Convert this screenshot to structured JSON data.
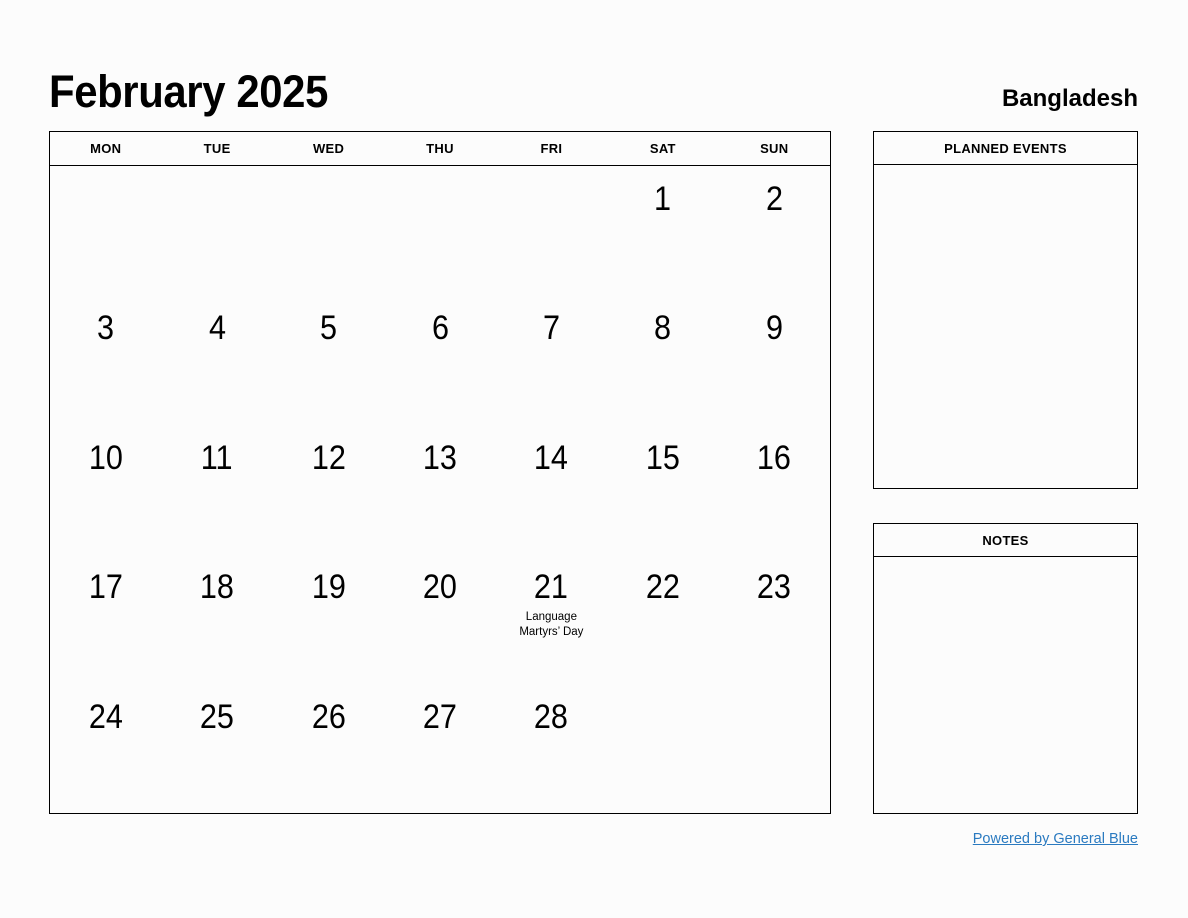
{
  "header": {
    "title": "February 2025",
    "country": "Bangladesh"
  },
  "calendar": {
    "weekdays": [
      "MON",
      "TUE",
      "WED",
      "THU",
      "FRI",
      "SAT",
      "SUN"
    ],
    "weeks": [
      [
        {
          "day": ""
        },
        {
          "day": ""
        },
        {
          "day": ""
        },
        {
          "day": ""
        },
        {
          "day": ""
        },
        {
          "day": "1"
        },
        {
          "day": "2"
        }
      ],
      [
        {
          "day": "3"
        },
        {
          "day": "4"
        },
        {
          "day": "5"
        },
        {
          "day": "6"
        },
        {
          "day": "7"
        },
        {
          "day": "8"
        },
        {
          "day": "9"
        }
      ],
      [
        {
          "day": "10"
        },
        {
          "day": "11"
        },
        {
          "day": "12"
        },
        {
          "day": "13"
        },
        {
          "day": "14"
        },
        {
          "day": "15"
        },
        {
          "day": "16"
        }
      ],
      [
        {
          "day": "17"
        },
        {
          "day": "18"
        },
        {
          "day": "19"
        },
        {
          "day": "20"
        },
        {
          "day": "21",
          "event": "Language Martyrs’ Day"
        },
        {
          "day": "22"
        },
        {
          "day": "23"
        }
      ],
      [
        {
          "day": "24"
        },
        {
          "day": "25"
        },
        {
          "day": "26"
        },
        {
          "day": "27"
        },
        {
          "day": "28"
        },
        {
          "day": ""
        },
        {
          "day": ""
        }
      ]
    ]
  },
  "sidebar": {
    "planned_events_title": "PLANNED EVENTS",
    "notes_title": "NOTES"
  },
  "footer": {
    "link_text": "Powered by General Blue",
    "link_color": "#2a7ac0"
  }
}
